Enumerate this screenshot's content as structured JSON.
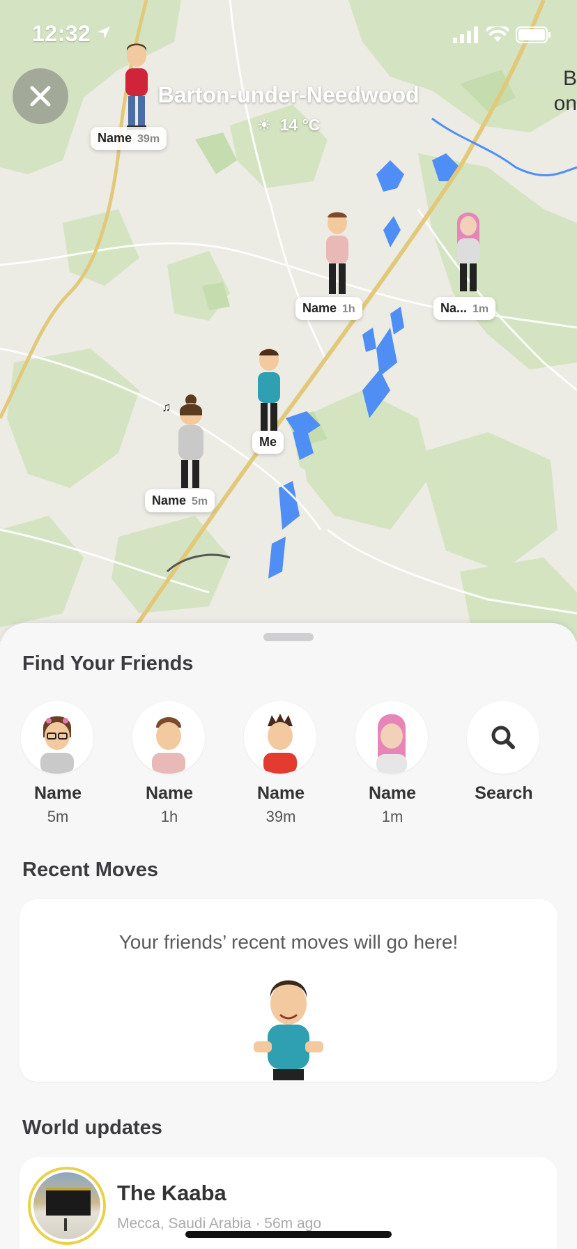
{
  "status_bar": {
    "time": "12:32"
  },
  "header": {
    "close_icon": "close-icon",
    "place": "Barton-under-Needwood",
    "weather": "14 °C",
    "edge_text_1": "B",
    "edge_text_2": "on"
  },
  "map_pins": [
    {
      "name": "Name",
      "time": "39m"
    },
    {
      "name": "Name",
      "time": "1h"
    },
    {
      "name": "Na...",
      "time": "1m"
    },
    {
      "name": "Me"
    },
    {
      "name": "Name",
      "time": "5m"
    }
  ],
  "sheet": {
    "find_friends_title": "Find Your Friends",
    "friends": [
      {
        "name": "Name",
        "time": "5m"
      },
      {
        "name": "Name",
        "time": "1h"
      },
      {
        "name": "Name",
        "time": "39m"
      },
      {
        "name": "Name",
        "time": "1m"
      }
    ],
    "search_label": "Search",
    "recent_moves_title": "Recent Moves",
    "recent_moves_empty": "Your friends’ recent moves will go here!",
    "world_updates_title": "World updates",
    "world_item": {
      "title": "The Kaaba",
      "subtitle": "Mecca, Saudi Arabia · 56m ago"
    }
  },
  "colors": {
    "map_bg": "#ecebe4",
    "green": "#cfe0b8",
    "water": "#4f8ef5",
    "road": "#d9c26b",
    "story_ring": "#e9d24a"
  }
}
